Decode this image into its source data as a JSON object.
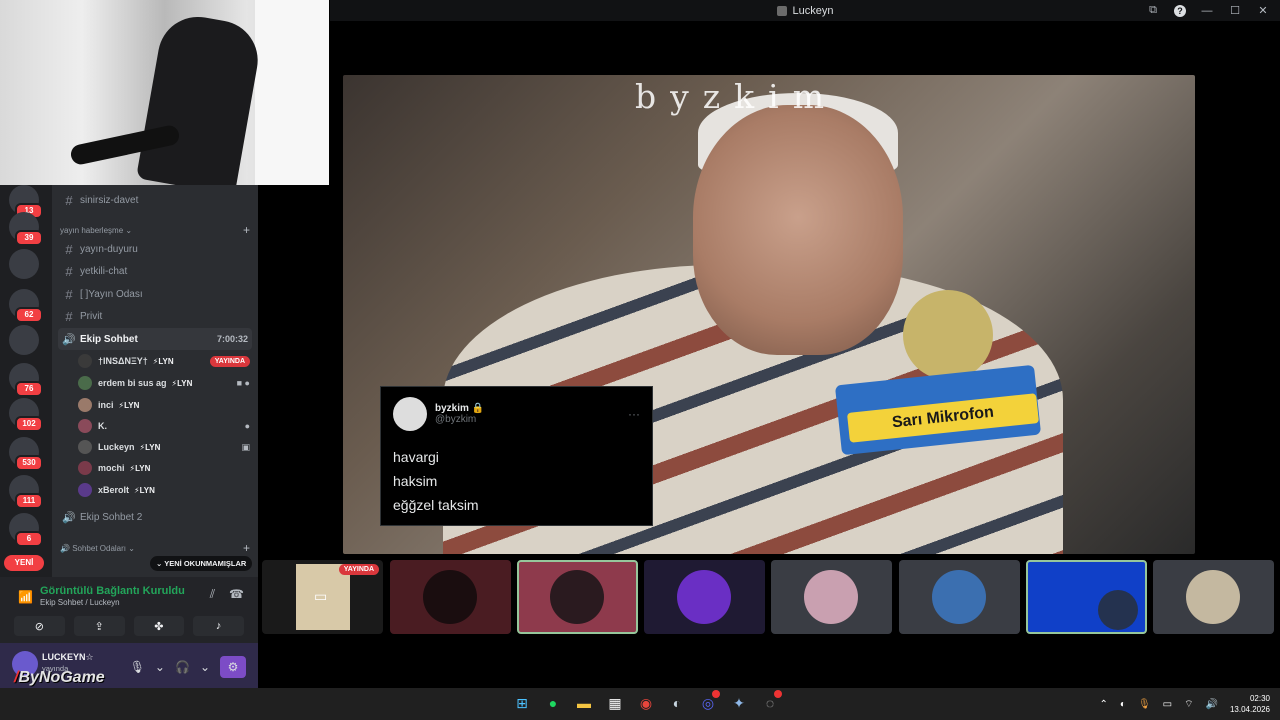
{
  "window": {
    "title": "Luckeyn",
    "controls": [
      "minimize",
      "maximize",
      "close"
    ]
  },
  "servers": [
    {
      "badge": "13"
    },
    {
      "badge": "39"
    },
    {
      "badge": ""
    },
    {
      "badge": "62"
    },
    {
      "badge": ""
    },
    {
      "badge": "76"
    },
    {
      "badge": "102"
    },
    {
      "badge": "530"
    },
    {
      "badge": "111"
    },
    {
      "badge": "6"
    },
    {
      "badge": "YENİ"
    }
  ],
  "channels": {
    "ch1": "sinirsiz-davet",
    "cat1": "yayın haberleşme",
    "ch2": "yayın-duyuru",
    "ch3": "yetkili-chat",
    "ch4": "[ ]Yayın Odası",
    "ch5": "Privit",
    "voice1": "Ekip Sohbet",
    "voice1_time": "7:00:32",
    "voice2": "Ekip Sohbet 2",
    "cat2": "Sohbet Odaları",
    "unread": "YENİ OKUNMAMIŞLAR"
  },
  "voice_users": [
    {
      "name": "†ΙΝЅΔΝΞΥ†",
      "tag": "LYN",
      "live": "YAYINDA"
    },
    {
      "name": "erdem bi sus ag",
      "tag": "LYN"
    },
    {
      "name": "inci",
      "tag": "LYN"
    },
    {
      "name": "K.",
      "tag": ""
    },
    {
      "name": "Luckeyn",
      "tag": "LYN"
    },
    {
      "name": "mochi",
      "tag": "LYN"
    },
    {
      "name": "xBeroIt",
      "tag": "LYN"
    }
  ],
  "voice_panel": {
    "title": "Görüntülü Bağlantı Kuruldu",
    "subtitle": "Ekip Sohbet / Luckeyn"
  },
  "user_panel": {
    "name": "LUCKEYN☆",
    "status": "yayında",
    "logo_prefix": "/",
    "logo": "ByNoGame"
  },
  "stream": {
    "watermark": "byzkim",
    "mic_label": "Sarı Mikrofon"
  },
  "tweet": {
    "name": "byzkim",
    "handle": "@byzkim",
    "lines": [
      "havargi",
      "haksim",
      "eğğzel taksim"
    ]
  },
  "strip": {
    "live_label": "YAYINDA"
  },
  "taskbar": {
    "time": "02:30",
    "date": "13.04.2026"
  },
  "colors": {
    "accent_green": "#23a55a",
    "live_red": "#da373c",
    "selected_border": "#96c69b"
  }
}
